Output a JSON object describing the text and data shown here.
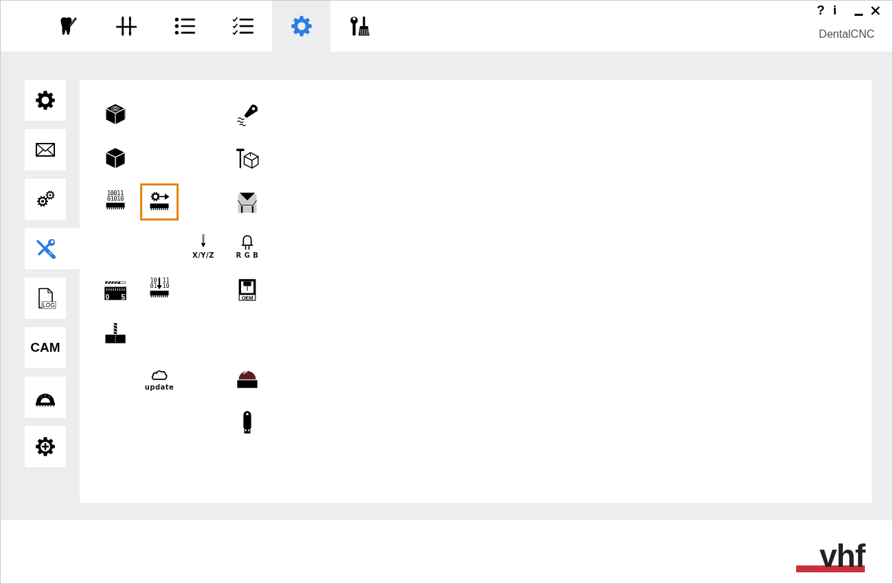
{
  "toolbar": {
    "tabs": [
      {
        "kind": "tooth",
        "selected": false
      },
      {
        "kind": "sliders",
        "selected": false
      },
      {
        "kind": "list",
        "selected": false
      },
      {
        "kind": "checklist",
        "selected": false
      },
      {
        "kind": "gear",
        "selected": true
      },
      {
        "kind": "tools",
        "selected": false
      }
    ]
  },
  "window_controls": {
    "help": "?",
    "info": "i"
  },
  "app_name": "DentalCNC",
  "sidebar": {
    "items": [
      {
        "kind": "gear",
        "selected": false
      },
      {
        "kind": "envelope",
        "selected": false
      },
      {
        "kind": "gears",
        "selected": false
      },
      {
        "kind": "wrench-screwdriver",
        "selected": true
      },
      {
        "kind": "log",
        "label": "LOG",
        "selected": false
      },
      {
        "kind": "text",
        "label": "CAM",
        "selected": false
      },
      {
        "kind": "protractor",
        "selected": false
      },
      {
        "kind": "gear-plus",
        "selected": false
      }
    ]
  },
  "panel": {
    "rows": [
      {
        "cells": [
          {
            "kind": "cube-disc",
            "selected": false
          },
          null,
          null,
          {
            "kind": "probe",
            "selected": false
          }
        ]
      },
      {
        "cells": [
          {
            "kind": "cube",
            "selected": false
          },
          null,
          null,
          {
            "kind": "tool-box",
            "selected": false
          }
        ]
      },
      {
        "cells": [
          {
            "kind": "chip-binary",
            "labels": [
              "10011",
              "01010"
            ],
            "selected": false
          },
          {
            "kind": "chip-gear",
            "selected": true
          },
          null,
          {
            "kind": "clamp",
            "selected": false
          }
        ]
      },
      {
        "cells": [
          null,
          null,
          {
            "kind": "axis-arrow",
            "caption": "X/Y/Z",
            "selected": false
          },
          {
            "kind": "led",
            "caption": "R G B",
            "selected": false
          }
        ]
      },
      {
        "cells": [
          {
            "kind": "ruler",
            "labels": [
              "0",
              "5"
            ],
            "selected": false
          },
          {
            "kind": "chip-download",
            "labels": [
              "10",
              "11",
              "01",
              "10"
            ],
            "selected": false
          },
          null,
          {
            "kind": "oem",
            "labels": [
              "OEM"
            ],
            "selected": false
          }
        ]
      },
      {
        "cells": [
          {
            "kind": "drill",
            "selected": false
          },
          null,
          null,
          null
        ]
      },
      {
        "cells": [
          null,
          {
            "kind": "cloud",
            "caption": "update",
            "selected": false
          },
          null,
          {
            "kind": "beacon",
            "selected": false
          }
        ]
      },
      {
        "cells": [
          null,
          null,
          null,
          {
            "kind": "usb",
            "selected": false
          }
        ]
      }
    ]
  },
  "footer": {
    "logo": "vhf"
  }
}
